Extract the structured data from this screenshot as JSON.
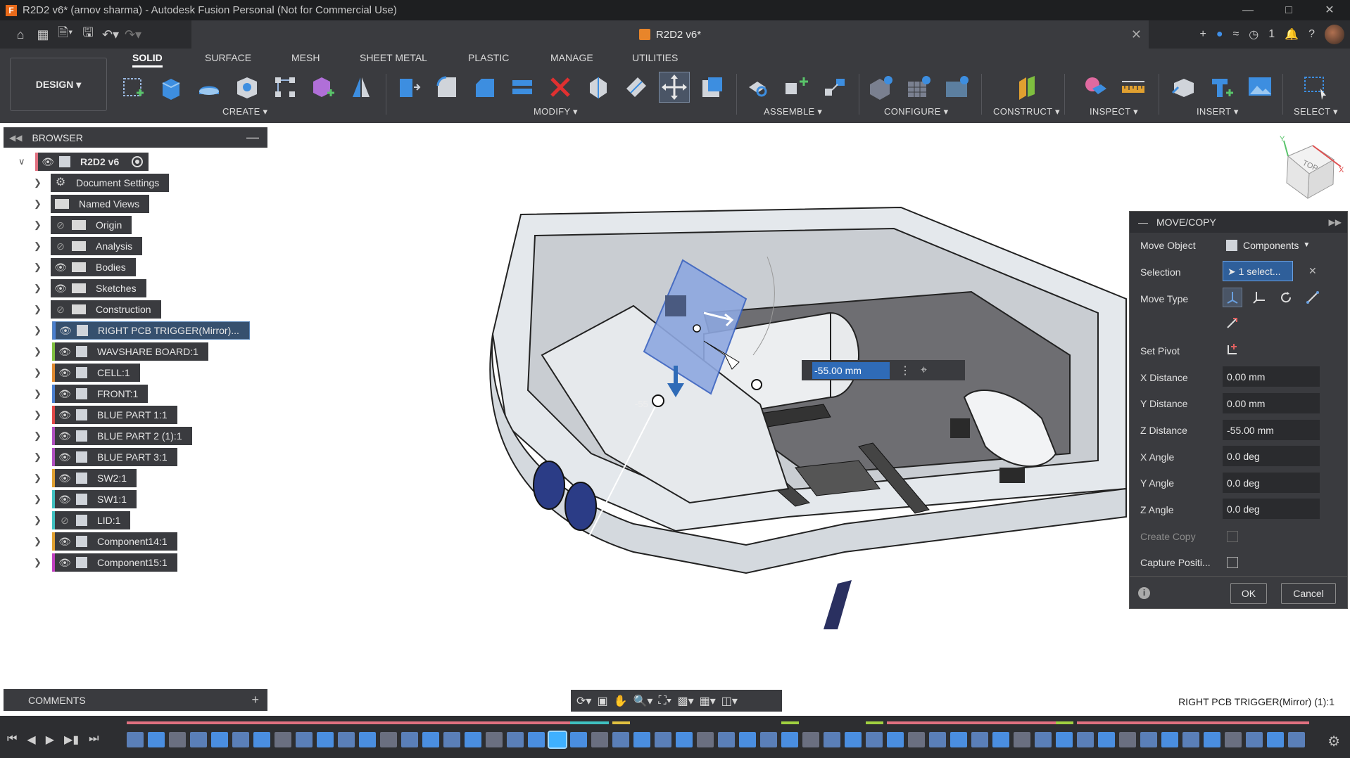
{
  "titlebar": {
    "title": "R2D2 v6* (arnov sharma) - Autodesk Fusion Personal (Not for Commercial Use)",
    "app_logo": "F"
  },
  "document": {
    "tab_title": "R2D2 v6*",
    "notification_count": "1"
  },
  "workspace": {
    "label": "DESIGN ▾"
  },
  "ribbon": {
    "tabs": [
      "SOLID",
      "SURFACE",
      "MESH",
      "SHEET METAL",
      "PLASTIC",
      "MANAGE",
      "UTILITIES"
    ],
    "active_tab": "SOLID",
    "groups": [
      "CREATE ▾",
      "MODIFY ▾",
      "ASSEMBLE ▾",
      "CONFIGURE ▾",
      "CONSTRUCT ▾",
      "INSPECT ▾",
      "INSERT ▾",
      "SELECT ▾"
    ]
  },
  "browser": {
    "title": "BROWSER",
    "root": "R2D2 v6",
    "items": [
      {
        "label": "Document Settings",
        "icon": "gear-icon",
        "visibility": "none"
      },
      {
        "label": "Named Views",
        "icon": "folder-icon",
        "visibility": "none"
      },
      {
        "label": "Origin",
        "icon": "folder-icon",
        "visibility": "hidden"
      },
      {
        "label": "Analysis",
        "icon": "folder-icon",
        "visibility": "hidden"
      },
      {
        "label": "Bodies",
        "icon": "folder-icon",
        "visibility": "shown"
      },
      {
        "label": "Sketches",
        "icon": "folder-icon",
        "visibility": "shown"
      },
      {
        "label": "Construction",
        "icon": "folder-icon",
        "visibility": "hidden"
      },
      {
        "label": "RIGHT PCB TRIGGER(Mirror)...",
        "icon": "component-icon",
        "visibility": "shown",
        "color": "#4a7fd0",
        "selected": true
      },
      {
        "label": "WAVSHARE BOARD:1",
        "icon": "component-icon",
        "visibility": "shown",
        "color": "#7fbf3f"
      },
      {
        "label": "CELL:1",
        "icon": "component-icon",
        "visibility": "shown",
        "color": "#e08a30"
      },
      {
        "label": "FRONT:1",
        "icon": "component-icon",
        "visibility": "shown",
        "color": "#4a7fd0"
      },
      {
        "label": "BLUE PART 1:1",
        "icon": "component-icon",
        "visibility": "shown",
        "color": "#e04848"
      },
      {
        "label": "BLUE PART 2 (1):1",
        "icon": "component-icon",
        "visibility": "shown",
        "color": "#b04fc0"
      },
      {
        "label": "BLUE PART 3:1",
        "icon": "component-icon",
        "visibility": "shown",
        "color": "#b04fc0"
      },
      {
        "label": "SW2:1",
        "icon": "component-icon",
        "visibility": "shown",
        "color": "#e0a030"
      },
      {
        "label": "SW1:1",
        "icon": "component-icon",
        "visibility": "shown",
        "color": "#3fc0c0"
      },
      {
        "label": "LID:1",
        "icon": "component-icon",
        "visibility": "hidden",
        "color": "#3fc0c0"
      },
      {
        "label": "Component14:1",
        "icon": "component-icon",
        "visibility": "shown",
        "color": "#e0a030"
      },
      {
        "label": "Component15:1",
        "icon": "component-icon",
        "visibility": "shown",
        "color": "#c040c0"
      }
    ]
  },
  "comments": {
    "label": "COMMENTS"
  },
  "viewport": {
    "input_value": "-55.00 mm",
    "partial_label": "-55"
  },
  "viewcube": {
    "face": "TOP",
    "x_label": "X",
    "y_label": "Y"
  },
  "move_copy": {
    "title": "MOVE/COPY",
    "move_object_label": "Move Object",
    "move_object_value": "Components",
    "selection_label": "Selection",
    "selection_value": "1 select...",
    "move_type_label": "Move Type",
    "set_pivot_label": "Set Pivot",
    "fields": [
      {
        "label": "X Distance",
        "value": "0.00 mm"
      },
      {
        "label": "Y Distance",
        "value": "0.00 mm"
      },
      {
        "label": "Z Distance",
        "value": "-55.00 mm"
      },
      {
        "label": "X Angle",
        "value": "0.0 deg"
      },
      {
        "label": "Y Angle",
        "value": "0.0 deg"
      },
      {
        "label": "Z Angle",
        "value": "0.0 deg"
      }
    ],
    "create_copy_label": "Create Copy",
    "capture_position_label": "Capture Positi...",
    "ok_label": "OK",
    "cancel_label": "Cancel"
  },
  "status": {
    "selection_text": "RIGHT PCB TRIGGER(Mirror) (1):1"
  },
  "colors": {
    "accent": "#2f6bb7",
    "panel": "#3a3b3f",
    "selected": "#36506e",
    "timeline": "#2d2e31"
  }
}
